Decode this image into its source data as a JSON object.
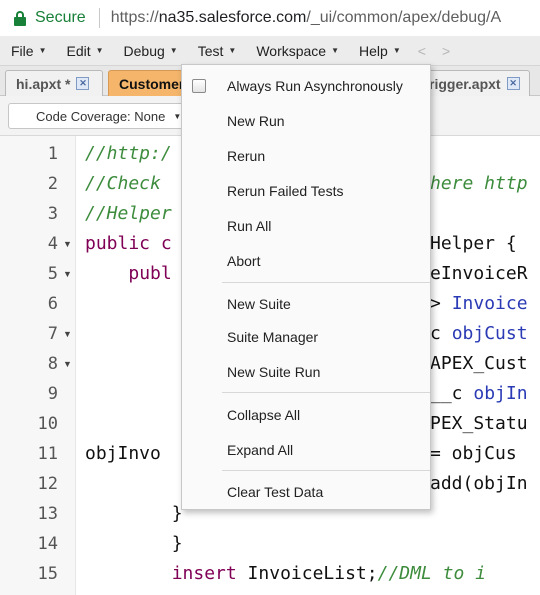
{
  "browser": {
    "secure_label": "Secure",
    "url_scheme": "https://",
    "url_host": "na35.salesforce.com",
    "url_path": "/_ui/common/apex/debug/A"
  },
  "menubar": {
    "items": [
      {
        "label": "File"
      },
      {
        "label": "Edit"
      },
      {
        "label": "Debug"
      },
      {
        "label": "Test"
      },
      {
        "label": "Workspace"
      },
      {
        "label": "Help"
      }
    ],
    "back": "<",
    "forward": ">"
  },
  "tabs": [
    {
      "label": "hi.apxt *",
      "active": false
    },
    {
      "label": "Customer",
      "active": true
    },
    {
      "label": "rigger.apxt",
      "active": false
    }
  ],
  "toolbar": {
    "code_coverage": "Code Coverage: None"
  },
  "editor": {
    "lines": [
      {
        "n": "1",
        "fold": false,
        "segs": [
          {
            "c": "cmt",
            "t": "//http:/"
          }
        ]
      },
      {
        "n": "2",
        "fold": false,
        "segs": [
          {
            "c": "cmt",
            "t": "//Check"
          }
        ]
      },
      {
        "n": "3",
        "fold": false,
        "segs": [
          {
            "c": "cmt",
            "t": "//Helper"
          }
        ]
      },
      {
        "n": "4",
        "fold": true,
        "segs": [
          {
            "c": "kw",
            "t": "public c"
          }
        ]
      },
      {
        "n": "5",
        "fold": true,
        "segs": [
          {
            "c": "pl",
            "t": "    "
          },
          {
            "c": "kw",
            "t": "publ"
          }
        ]
      },
      {
        "n": "6",
        "fold": false,
        "segs": []
      },
      {
        "n": "7",
        "fold": true,
        "segs": []
      },
      {
        "n": "8",
        "fold": true,
        "segs": []
      },
      {
        "n": "9",
        "fold": false,
        "segs": []
      },
      {
        "n": "10",
        "fold": false,
        "segs": []
      },
      {
        "n": "11",
        "fold": false,
        "segs": [
          {
            "c": "pl",
            "t": "objInvo"
          }
        ]
      },
      {
        "n": "12",
        "fold": false,
        "segs": []
      },
      {
        "n": "13",
        "fold": false,
        "segs": [
          {
            "c": "pl",
            "t": "        }"
          }
        ]
      },
      {
        "n": "14",
        "fold": false,
        "segs": [
          {
            "c": "pl",
            "t": "        }"
          }
        ]
      },
      {
        "n": "15",
        "fold": false,
        "segs": [
          {
            "c": "kw",
            "t": "        insert"
          },
          {
            "c": "pl",
            "t": " InvoiceList;"
          },
          {
            "c": "cmt",
            "t": "//DML to i"
          }
        ]
      }
    ],
    "right_fragments": [
      {
        "line": 2,
        "segs": [
          {
            "c": "cmt",
            "t": "here http"
          }
        ]
      },
      {
        "line": 4,
        "segs": [
          {
            "c": "pl",
            "t": "Helper {"
          }
        ]
      },
      {
        "line": 5,
        "segs": [
          {
            "c": "pl",
            "t": "eInvoiceR"
          }
        ]
      },
      {
        "line": 6,
        "segs": [
          {
            "c": "pl",
            "t": "> "
          },
          {
            "c": "ty",
            "t": "Invoice"
          }
        ]
      },
      {
        "line": 7,
        "segs": [
          {
            "c": "pl",
            "t": "c "
          },
          {
            "c": "ty",
            "t": "objCust"
          }
        ]
      },
      {
        "line": 8,
        "segs": [
          {
            "c": "pl",
            "t": "APEX_Cust"
          }
        ]
      },
      {
        "line": 9,
        "segs": [
          {
            "c": "pl",
            "t": "__c "
          },
          {
            "c": "ty",
            "t": "objIn"
          }
        ]
      },
      {
        "line": 10,
        "segs": [
          {
            "c": "pl",
            "t": "PEX_Statu"
          }
        ]
      },
      {
        "line": 11,
        "segs": [
          {
            "c": "pl",
            "t": "= objCus"
          }
        ]
      },
      {
        "line": 12,
        "segs": [
          {
            "c": "pl",
            "t": "add(objIn"
          }
        ]
      }
    ]
  },
  "test_menu": {
    "items": [
      {
        "label": "Always Run Asynchronously",
        "checkbox": true
      },
      {
        "label": "New Run"
      },
      {
        "label": "Rerun"
      },
      {
        "label": "Rerun Failed Tests"
      },
      {
        "label": "Run All"
      },
      {
        "label": "Abort"
      },
      {
        "label": "New Suite"
      },
      {
        "label": "Suite Manager"
      },
      {
        "label": "New Suite Run"
      },
      {
        "label": "Collapse All"
      },
      {
        "label": "Expand All"
      },
      {
        "label": "Clear Test Data"
      }
    ]
  }
}
